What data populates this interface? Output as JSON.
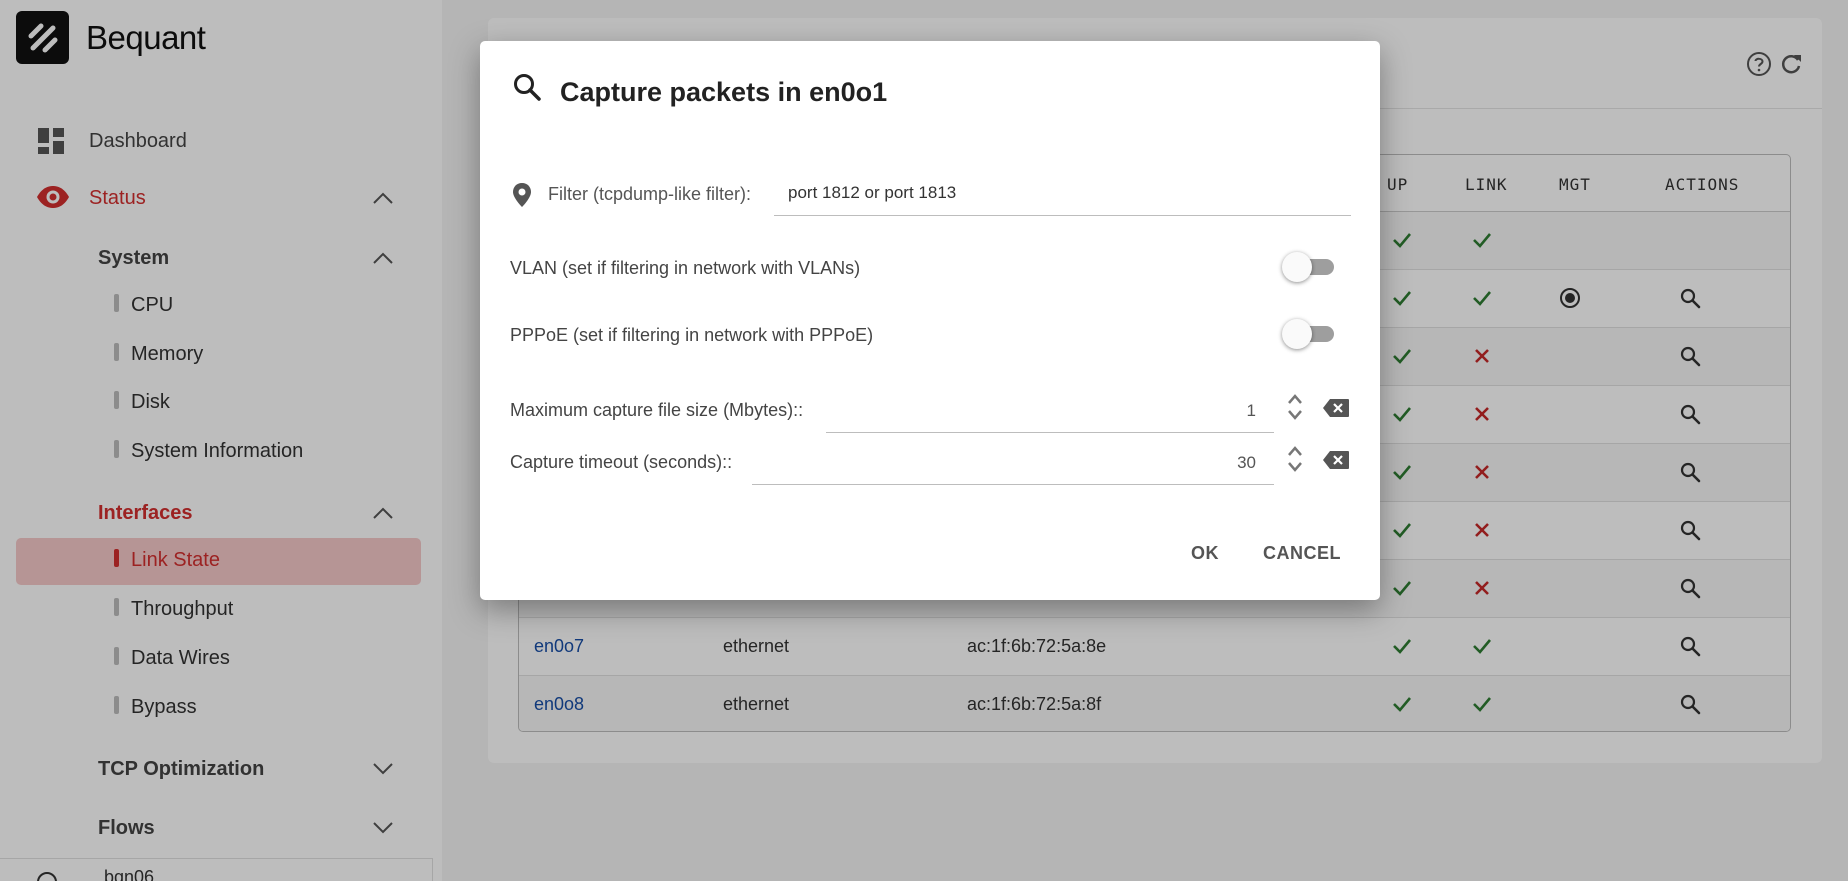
{
  "brand": {
    "name": "Bequant"
  },
  "sidebar": {
    "dashboard": "Dashboard",
    "status": "Status",
    "system": "System",
    "system_items": [
      "CPU",
      "Memory",
      "Disk",
      "System Information"
    ],
    "interfaces": "Interfaces",
    "interface_items": [
      "Link State",
      "Throughput",
      "Data Wires",
      "Bypass"
    ],
    "tcp_optimization": "TCP Optimization",
    "flows": "Flows",
    "footer_user": "bqn06"
  },
  "table": {
    "headers": {
      "up": "UP",
      "link": "LINK",
      "mgt": "MGT",
      "actions": "ACTIONS"
    },
    "rows": [
      {
        "name": "",
        "type": "",
        "mac": "",
        "up": "check",
        "link": "check",
        "mgt": false,
        "action": false
      },
      {
        "name": "",
        "type": "",
        "mac": "",
        "up": "check",
        "link": "check",
        "mgt": true,
        "action": true
      },
      {
        "name": "",
        "type": "",
        "mac": "",
        "up": "check",
        "link": "cross",
        "mgt": false,
        "action": true
      },
      {
        "name": "",
        "type": "",
        "mac": "",
        "up": "check",
        "link": "cross",
        "mgt": false,
        "action": true
      },
      {
        "name": "",
        "type": "",
        "mac": "",
        "up": "check",
        "link": "cross",
        "mgt": false,
        "action": true
      },
      {
        "name": "",
        "type": "",
        "mac": "",
        "up": "check",
        "link": "cross",
        "mgt": false,
        "action": true
      },
      {
        "name": "",
        "type": "",
        "mac": "",
        "up": "check",
        "link": "cross",
        "mgt": false,
        "action": true
      },
      {
        "name": "en0o7",
        "type": "ethernet",
        "mac": "ac:1f:6b:72:5a:8e",
        "up": "check",
        "link": "check",
        "mgt": false,
        "action": true
      },
      {
        "name": "en0o8",
        "type": "ethernet",
        "mac": "ac:1f:6b:72:5a:8f",
        "up": "check",
        "link": "check",
        "mgt": false,
        "action": true
      }
    ]
  },
  "dialog": {
    "title": "Capture packets in en0o1",
    "filter_label": "Filter (tcpdump-like filter):",
    "filter_value": "port 1812 or port 1813",
    "vlan_label": "VLAN (set if filtering in network with VLANs)",
    "vlan_enabled": false,
    "pppoe_label": "PPPoE (set if filtering in network with PPPoE)",
    "pppoe_enabled": false,
    "max_size_label": "Maximum capture file size (Mbytes)::",
    "max_size_value": "1",
    "timeout_label": "Capture timeout (seconds)::",
    "timeout_value": "30",
    "ok_label": "OK",
    "cancel_label": "CANCEL"
  },
  "colors": {
    "accent": "#d32f2f",
    "check": "#2e7d32",
    "cross": "#c62828",
    "link": "#174ea6"
  }
}
